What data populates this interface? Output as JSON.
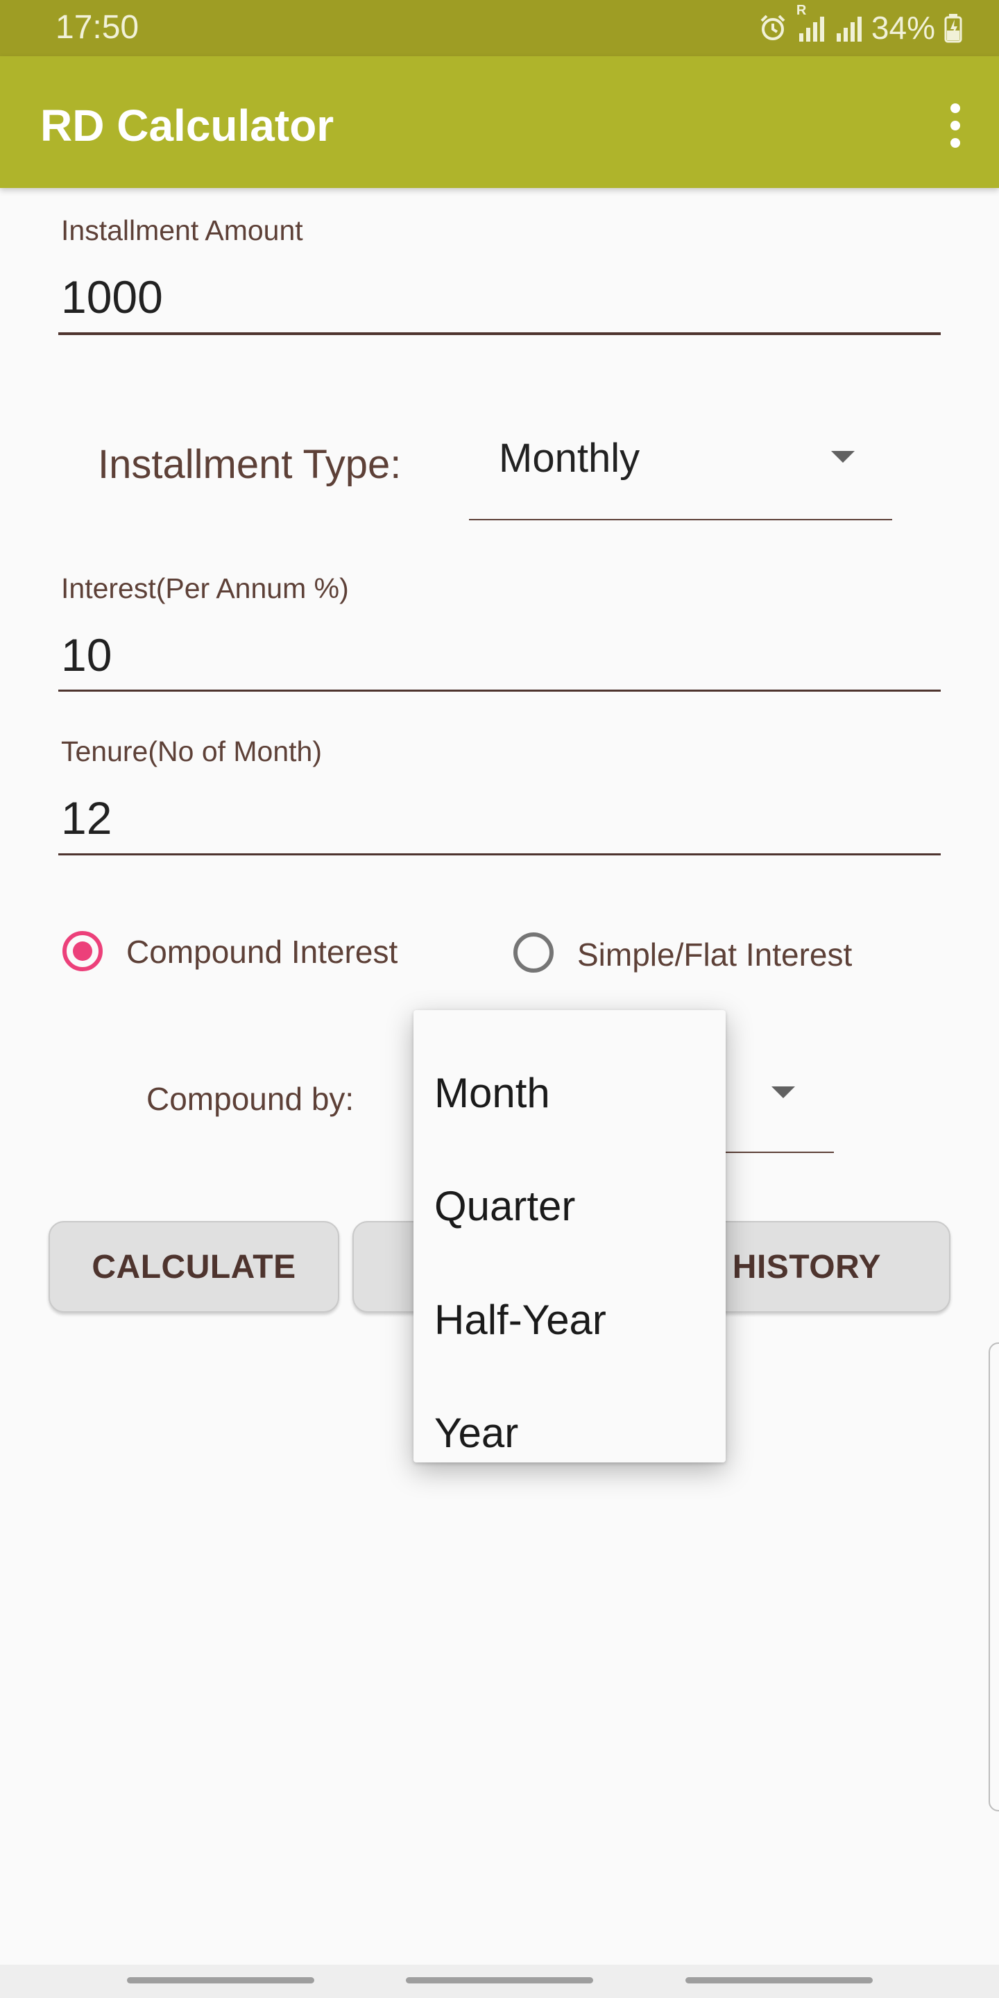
{
  "status_bar": {
    "time": "17:50",
    "signal_label": "R",
    "battery_text": "34%",
    "icons": [
      "alarm-icon",
      "signal-icon",
      "signal-icon",
      "battery-charging-icon"
    ]
  },
  "app_bar": {
    "title": "RD Calculator",
    "background": "#afb42b",
    "status_background": "#9e9d24",
    "menu_icon": "more-vert-icon"
  },
  "form": {
    "installment_amount": {
      "label": "Installment Amount",
      "value": "1000"
    },
    "installment_type": {
      "label": "Installment Type:",
      "selected": "Monthly"
    },
    "interest": {
      "label": "Interest(Per Annum %)",
      "value": "10"
    },
    "tenure": {
      "label": "Tenure(No of Month)",
      "value": "12"
    },
    "interest_mode": {
      "options": [
        {
          "label": "Compound Interest",
          "checked": true
        },
        {
          "label": "Simple/Flat Interest",
          "checked": false
        }
      ],
      "accent": "#ec407a"
    },
    "compound_by": {
      "label": "Compound by:"
    }
  },
  "buttons": {
    "calculate": "CALCULATE",
    "history": "HISTORY"
  },
  "dropdown": {
    "options": [
      "Month",
      "Quarter",
      "Half-Year",
      "Year"
    ]
  }
}
